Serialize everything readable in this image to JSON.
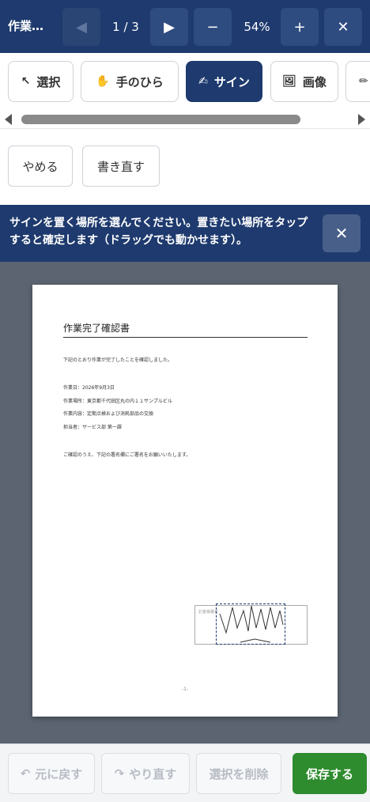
{
  "header": {
    "title": "作業…",
    "page_indicator": "1 / 3",
    "zoom": "54%",
    "prev_icon": "◀",
    "next_icon": "▶",
    "zoom_out": "−",
    "zoom_in": "+",
    "close": "✕"
  },
  "tools": [
    {
      "label": "選択",
      "icon": "↖"
    },
    {
      "label": "手のひら",
      "icon": "✋"
    },
    {
      "label": "サイン",
      "icon": "✍"
    },
    {
      "label": "画像",
      "icon": "🖼"
    },
    {
      "label": "",
      "icon": "✏"
    }
  ],
  "sign_actions": {
    "cancel": "やめる",
    "redo_sign": "書き直す"
  },
  "banner": {
    "text": "サインを置く場所を選んでください。置きたい場所をタップすると確定します（ドラッグでも動かせます）。",
    "close": "✕"
  },
  "document": {
    "title": "作業完了確認書",
    "intro": "下記のとおり作業が完了したことを確認しました。",
    "date": "作業日：2026年9月3日",
    "location": "作業場所：東京都千代田区丸の内１１サンプルビル",
    "content": "作業内容：定期点検および消耗部品の交換",
    "person": "担当者：サービス部 第一課",
    "request": "ご確認のうえ、下記の署名欄にご署名をお願いいたします。",
    "sign_label": "お客様署名",
    "page_number": "-1-"
  },
  "bottom": {
    "undo": "元に戻す",
    "redo": "やり直す",
    "delete": "選択を削除",
    "save": "保存する",
    "undo_icon": "↶",
    "redo_icon": "↷"
  },
  "colors": {
    "primary": "#1e3a6e",
    "save": "#2e8b2e",
    "canvas": "#5b6470"
  }
}
